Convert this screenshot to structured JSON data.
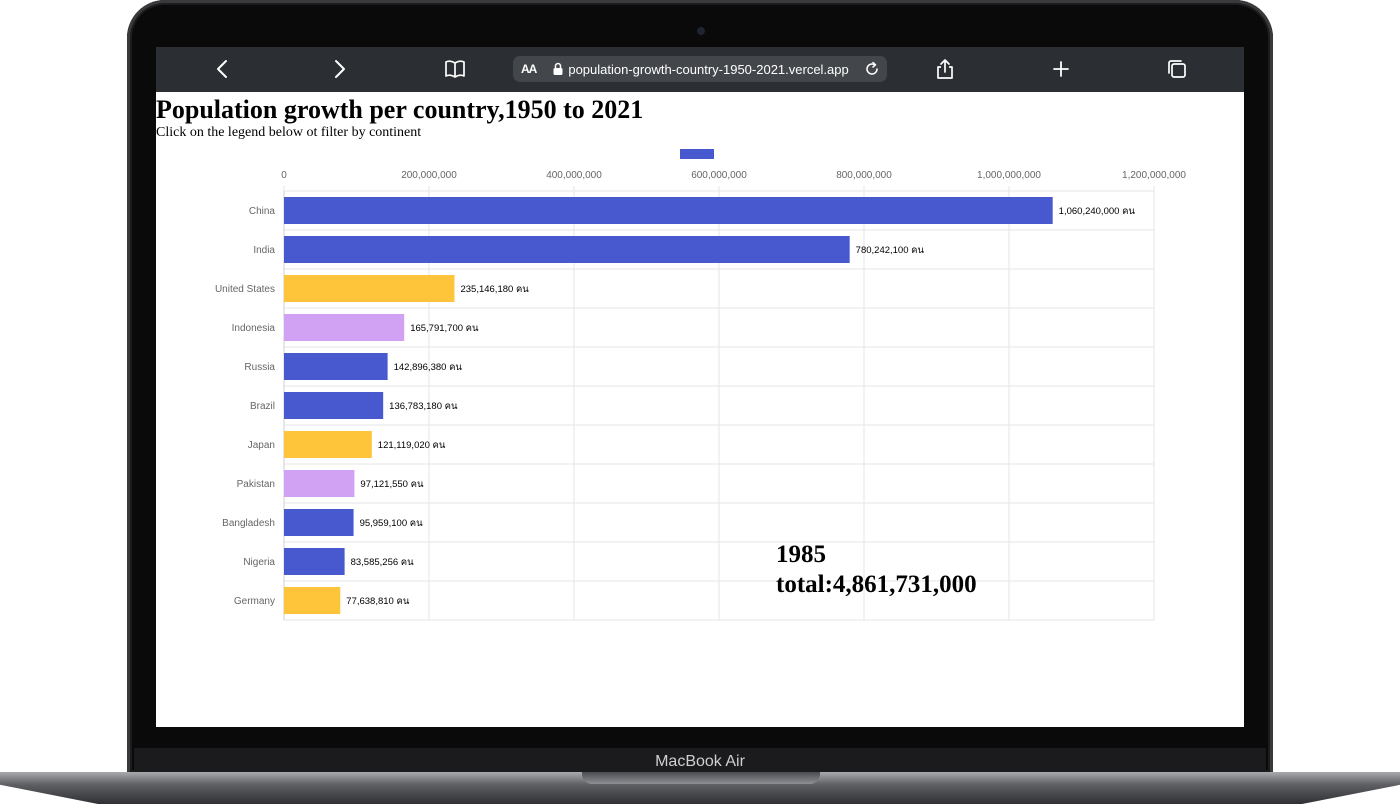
{
  "device": {
    "label": "MacBook Air"
  },
  "browser": {
    "url": "population-growth-country-1950-2021.vercel.app",
    "aa_label": "AA"
  },
  "page": {
    "title": "Population growth per country,1950 to 2021",
    "subtitle": "Click on the legend below ot filter by continent"
  },
  "year_display": {
    "year": "1985",
    "total": "total:4,861,731,000"
  },
  "colors": {
    "blue": "#4858cf",
    "yellow": "#ffc53a",
    "lavender": "#d1a2f4"
  },
  "chart_data": {
    "type": "bar",
    "orientation": "horizontal",
    "categories": [
      "China",
      "India",
      "United States",
      "Indonesia",
      "Russia",
      "Brazil",
      "Japan",
      "Pakistan",
      "Bangladesh",
      "Nigeria",
      "Germany"
    ],
    "values": [
      1060240000,
      780242100,
      235146180,
      165791700,
      142896380,
      136783180,
      121119020,
      97121550,
      95959100,
      83585256,
      77638810
    ],
    "value_labels": [
      "1,060,240,000 คน",
      "780,242,100 คน",
      "235,146,180 คน",
      "165,791,700 คน",
      "142,896,380 คน",
      "136,783,180 คน",
      "121,119,020 คน",
      "97,121,550 คน",
      "95,959,100 คน",
      "83,585,256 คน",
      "77,638,810 คน"
    ],
    "bar_colors": [
      "#4858cf",
      "#4858cf",
      "#ffc53a",
      "#d1a2f4",
      "#4858cf",
      "#4858cf",
      "#ffc53a",
      "#d1a2f4",
      "#4858cf",
      "#4858cf",
      "#ffc53a"
    ],
    "xlim": [
      0,
      1200000000
    ],
    "x_ticks": [
      0,
      200000000,
      400000000,
      600000000,
      800000000,
      1000000000,
      1200000000
    ],
    "x_tick_labels": [
      "0",
      "200,000,000",
      "400,000,000",
      "600,000,000",
      "800,000,000",
      "1,000,000,000",
      "1,200,000,000"
    ],
    "axis_position": "top",
    "grid": true,
    "legend": {
      "placement": "top",
      "entries": [
        ""
      ]
    }
  }
}
